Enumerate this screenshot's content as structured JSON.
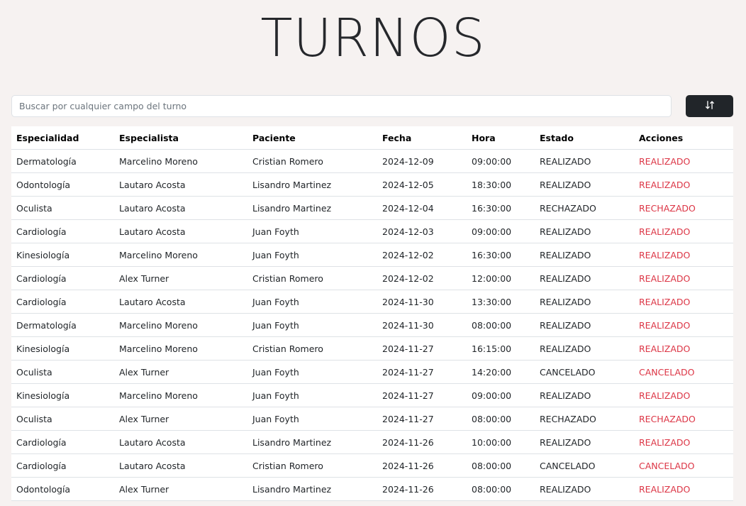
{
  "header": {
    "title": "TURNOS"
  },
  "search": {
    "placeholder": "Buscar por cualquier campo del turno",
    "value": ""
  },
  "sort_button": {
    "icon": "sort-arrows-icon"
  },
  "colors": {
    "accent_dark": "#212529",
    "action": "#dc3545",
    "background": "#f6f2f1"
  },
  "table": {
    "headers": {
      "especialidad": "Especialidad",
      "especialista": "Especialista",
      "paciente": "Paciente",
      "fecha": "Fecha",
      "hora": "Hora",
      "estado": "Estado",
      "acciones": "Acciones"
    },
    "rows": [
      {
        "especialidad": "Dermatología",
        "especialista": "Marcelino Moreno",
        "paciente": "Cristian Romero",
        "fecha": "2024-12-09",
        "hora": "09:00:00",
        "estado": "REALIZADO",
        "accion": "REALIZADO"
      },
      {
        "especialidad": "Odontología",
        "especialista": "Lautaro Acosta",
        "paciente": "Lisandro Martinez",
        "fecha": "2024-12-05",
        "hora": "18:30:00",
        "estado": "REALIZADO",
        "accion": "REALIZADO"
      },
      {
        "especialidad": "Oculista",
        "especialista": "Lautaro Acosta",
        "paciente": "Lisandro Martinez",
        "fecha": "2024-12-04",
        "hora": "16:30:00",
        "estado": "RECHAZADO",
        "accion": "RECHAZADO"
      },
      {
        "especialidad": "Cardiología",
        "especialista": "Lautaro Acosta",
        "paciente": "Juan Foyth",
        "fecha": "2024-12-03",
        "hora": "09:00:00",
        "estado": "REALIZADO",
        "accion": "REALIZADO"
      },
      {
        "especialidad": "Kinesiología",
        "especialista": "Marcelino Moreno",
        "paciente": "Juan Foyth",
        "fecha": "2024-12-02",
        "hora": "16:30:00",
        "estado": "REALIZADO",
        "accion": "REALIZADO"
      },
      {
        "especialidad": "Cardiología",
        "especialista": "Alex Turner",
        "paciente": "Cristian Romero",
        "fecha": "2024-12-02",
        "hora": "12:00:00",
        "estado": "REALIZADO",
        "accion": "REALIZADO"
      },
      {
        "especialidad": "Cardiología",
        "especialista": "Lautaro Acosta",
        "paciente": "Juan Foyth",
        "fecha": "2024-11-30",
        "hora": "13:30:00",
        "estado": "REALIZADO",
        "accion": "REALIZADO"
      },
      {
        "especialidad": "Dermatología",
        "especialista": "Marcelino Moreno",
        "paciente": "Juan Foyth",
        "fecha": "2024-11-30",
        "hora": "08:00:00",
        "estado": "REALIZADO",
        "accion": "REALIZADO"
      },
      {
        "especialidad": "Kinesiología",
        "especialista": "Marcelino Moreno",
        "paciente": "Cristian Romero",
        "fecha": "2024-11-27",
        "hora": "16:15:00",
        "estado": "REALIZADO",
        "accion": "REALIZADO"
      },
      {
        "especialidad": "Oculista",
        "especialista": "Alex Turner",
        "paciente": "Juan Foyth",
        "fecha": "2024-11-27",
        "hora": "14:20:00",
        "estado": "CANCELADO",
        "accion": "CANCELADO"
      },
      {
        "especialidad": "Kinesiología",
        "especialista": "Marcelino Moreno",
        "paciente": "Juan Foyth",
        "fecha": "2024-11-27",
        "hora": "09:00:00",
        "estado": "REALIZADO",
        "accion": "REALIZADO"
      },
      {
        "especialidad": "Oculista",
        "especialista": "Alex Turner",
        "paciente": "Juan Foyth",
        "fecha": "2024-11-27",
        "hora": "08:00:00",
        "estado": "RECHAZADO",
        "accion": "RECHAZADO"
      },
      {
        "especialidad": "Cardiología",
        "especialista": "Lautaro Acosta",
        "paciente": "Lisandro Martinez",
        "fecha": "2024-11-26",
        "hora": "10:00:00",
        "estado": "REALIZADO",
        "accion": "REALIZADO"
      },
      {
        "especialidad": "Cardiología",
        "especialista": "Lautaro Acosta",
        "paciente": "Cristian Romero",
        "fecha": "2024-11-26",
        "hora": "08:00:00",
        "estado": "CANCELADO",
        "accion": "CANCELADO"
      },
      {
        "especialidad": "Odontología",
        "especialista": "Alex Turner",
        "paciente": "Lisandro Martinez",
        "fecha": "2024-11-26",
        "hora": "08:00:00",
        "estado": "REALIZADO",
        "accion": "REALIZADO"
      }
    ]
  }
}
